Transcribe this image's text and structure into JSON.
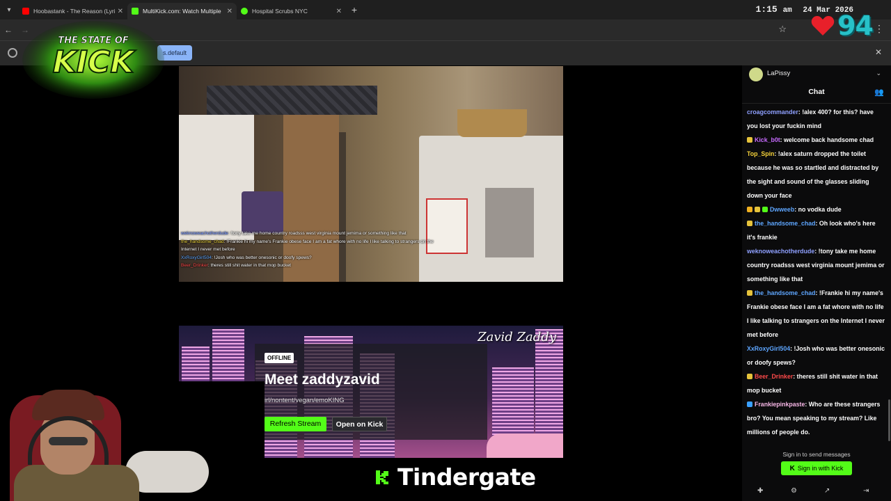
{
  "browser": {
    "tabs": [
      {
        "label": "Hoobastank - The Reason (Lyric",
        "favicon_color": "#ff0000"
      },
      {
        "label": "MultiKick.com: Watch Multiple",
        "favicon_color": "#53fc18"
      },
      {
        "label": "Hospital Scrubs NYC",
        "favicon_color": "#53fc18"
      }
    ],
    "infobar_chip": "s.default"
  },
  "clock": {
    "time": "1:15",
    "ampm": "am",
    "date": "24 Mar 2026"
  },
  "heart_counter": {
    "value": "94",
    "heart_color": "#e8202a",
    "number_color": "#27c1c8"
  },
  "logo": {
    "line1": "THE STATE OF",
    "line2": "KICK"
  },
  "stream1": {
    "chat_overlay": [
      {
        "user": "weknoweachotherdude",
        "text": "!tony take me home country roadsss west virginia mount jemima or something like that"
      },
      {
        "user": "the_handsome_chad",
        "text": "!Frankie hi my name's Frankie obese face I am a fat whore with no life I like talking to strangers on the Internet I never met before"
      },
      {
        "user": "XxRoxyGirl504",
        "text": "!Josh who was better onesonic or doofy spews?"
      },
      {
        "user": "Beer_Drinker",
        "text": "theres still shit water in that mop bucket"
      }
    ]
  },
  "stream2": {
    "channel_name": "Zavid Zaddy",
    "status_badge": "OFFLINE",
    "title": "Meet zaddyzavid",
    "description": "irl/nontent/vegan/emoKING",
    "refresh_label": "Refresh Stream",
    "open_label": "Open on Kick"
  },
  "ticker": {
    "text": "Tindergate"
  },
  "chat": {
    "user": "LaPissy",
    "title": "Chat",
    "messages": [
      {
        "user": "croagcommander",
        "color": "#8fa0ff",
        "text": "!alex 400? for this? have you lost your fuckin mind",
        "badges": []
      },
      {
        "user": "Kick_b0t",
        "color": "#c86bff",
        "text": "welcome back handsome chad",
        "badges": [
          "#e6c33b"
        ]
      },
      {
        "user": "Top_Spin",
        "color": "#f5d23a",
        "text": "!alex saturn dropped the toilet because he was so startled and distracted by the sight and sound of the glasses sliding down your face",
        "badges": []
      },
      {
        "user": "Dwweeb",
        "color": "#5ea6ff",
        "text": "no vodka dude",
        "badges": [
          "#f0b020",
          "#e6c33b",
          "#53fc18"
        ]
      },
      {
        "user": "the_handsome_chad",
        "color": "#5ea6ff",
        "text": "Oh look who's here it's frankie",
        "badges": [
          "#e6c33b"
        ]
      },
      {
        "user": "weknoweachotherdude",
        "color": "#8fa0ff",
        "text": "!tony take me home country roadsss west virginia mount jemima or something like that",
        "badges": []
      },
      {
        "user": "the_handsome_chad",
        "color": "#5ea6ff",
        "text": "!Frankie hi my name's Frankie obese face I am a fat whore with no life I like talking to strangers on the Internet I never met before",
        "badges": [
          "#e6c33b"
        ]
      },
      {
        "user": "XxRoxyGirl504",
        "color": "#5ea6ff",
        "text": "!Josh who was better onesonic or doofy spews?",
        "badges": []
      },
      {
        "user": "Beer_Drinker",
        "color": "#ff4a4a",
        "text": "theres still shit water in that mop bucket",
        "badges": [
          "#e6c33b"
        ]
      },
      {
        "user": "Frankiepinkpaste",
        "color": "#f7b6e6",
        "text": "Who are these strangers bro? You mean speaking to my stream? Like millions of people do.",
        "badges": [
          "#3aa0ff"
        ]
      }
    ],
    "signin_prompt": "Sign in to send messages",
    "signin_button": "Sign in with Kick"
  }
}
